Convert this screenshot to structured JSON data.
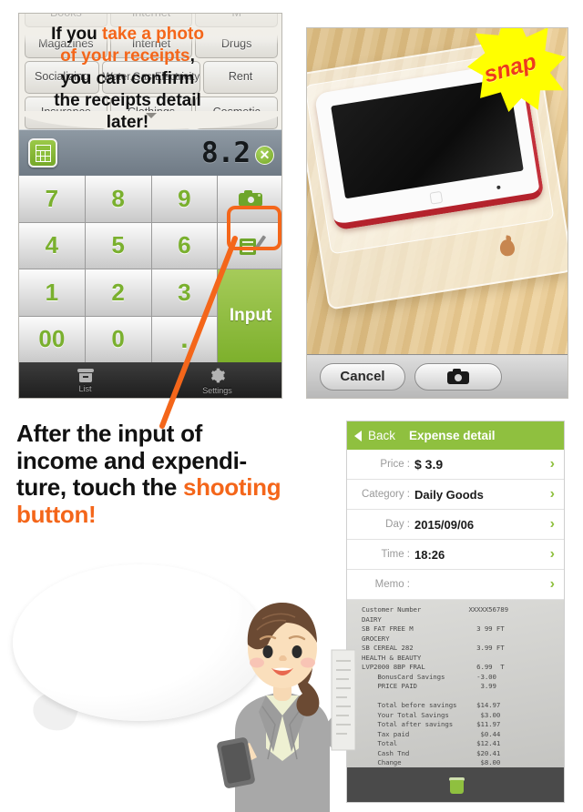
{
  "calculator_screen": {
    "categories_partial_top": [
      "Books",
      "Internet",
      "M"
    ],
    "category_rows": [
      [
        "Magazines",
        "Internet",
        "Drugs"
      ],
      [
        "Socializing",
        "Water,Gas,Electricity",
        "Rent"
      ],
      [
        "Insurance",
        "Clothings",
        "Cosmetic"
      ]
    ],
    "collapse_handle_icon": "chevron-down-icon",
    "display": {
      "calculator_icon": "calculator-icon",
      "value": "8.2",
      "clear_icon": "clear-circle-icon"
    },
    "keys": [
      "7",
      "8",
      "9",
      "camera-icon",
      "4",
      "5",
      "6",
      "memo-icon",
      "1",
      "2",
      "3",
      "00",
      "0",
      "."
    ],
    "input_button_label": "Input",
    "tabs": [
      {
        "label": "List",
        "icon": "list-box-icon"
      },
      {
        "label": "Settings",
        "icon": "gear-icon"
      }
    ],
    "highlight_color": "#f4661a",
    "accent_green": "#8fc03f"
  },
  "camera_screen": {
    "snap_badge": "snap",
    "photo_alt": "white and red iPod touch in clear plastic box on wooden desk",
    "cancel_label": "Cancel",
    "shoot_icon": "camera-icon"
  },
  "expense_detail": {
    "back_label": "Back",
    "back_icon": "chevron-left-icon",
    "title": "Expense detail",
    "rows": [
      {
        "label": "Price :",
        "value": "$ 3.9"
      },
      {
        "label": "Category :",
        "value": "Daily Goods"
      },
      {
        "label": "Day :",
        "value": "2015/09/06"
      },
      {
        "label": "Time :",
        "value": "18:26"
      },
      {
        "label": "Memo :",
        "value": ""
      }
    ],
    "row_chevron_icon": "chevron-right-icon",
    "receipt_text": "Customer Number            XXXXX56789\nDAIRY\nSB FAT FREE M                3 99 FT\nGROCERY\nSB CEREAL 282                3.99 FT\nHEALTH & BEAUTY\nLVP2000 8BP FRAL             6.99  T\n    BonusCard Savings        -3.00\n    PRICE PAID                3.99\n\n    Total before savings     $14.97\n    Your Total Savings        $3.00\n    Total after savings      $11.97\n    Tax paid                  $0.44\n    Total                    $12.41\n    Cash Tnd                 $20.41\n    Change                    $8.00",
    "delete_icon": "trash-icon"
  },
  "caption": {
    "line1": "After the input of",
    "line2": "income and expendi-",
    "line3_plain": "ture, touch the ",
    "line3_highlight": "shooting",
    "line4_highlight": "button!"
  },
  "speech_bubble": {
    "part1": "If you ",
    "part2_highlight": "take a photo",
    "part3_highlight": "of your receipts",
    "part4": ",",
    "part5": "you can confirm",
    "part6": "the receipts detail",
    "part7": "later!"
  },
  "character": {
    "description": "cartoon woman in gray suit holding smartphone and receipt"
  }
}
